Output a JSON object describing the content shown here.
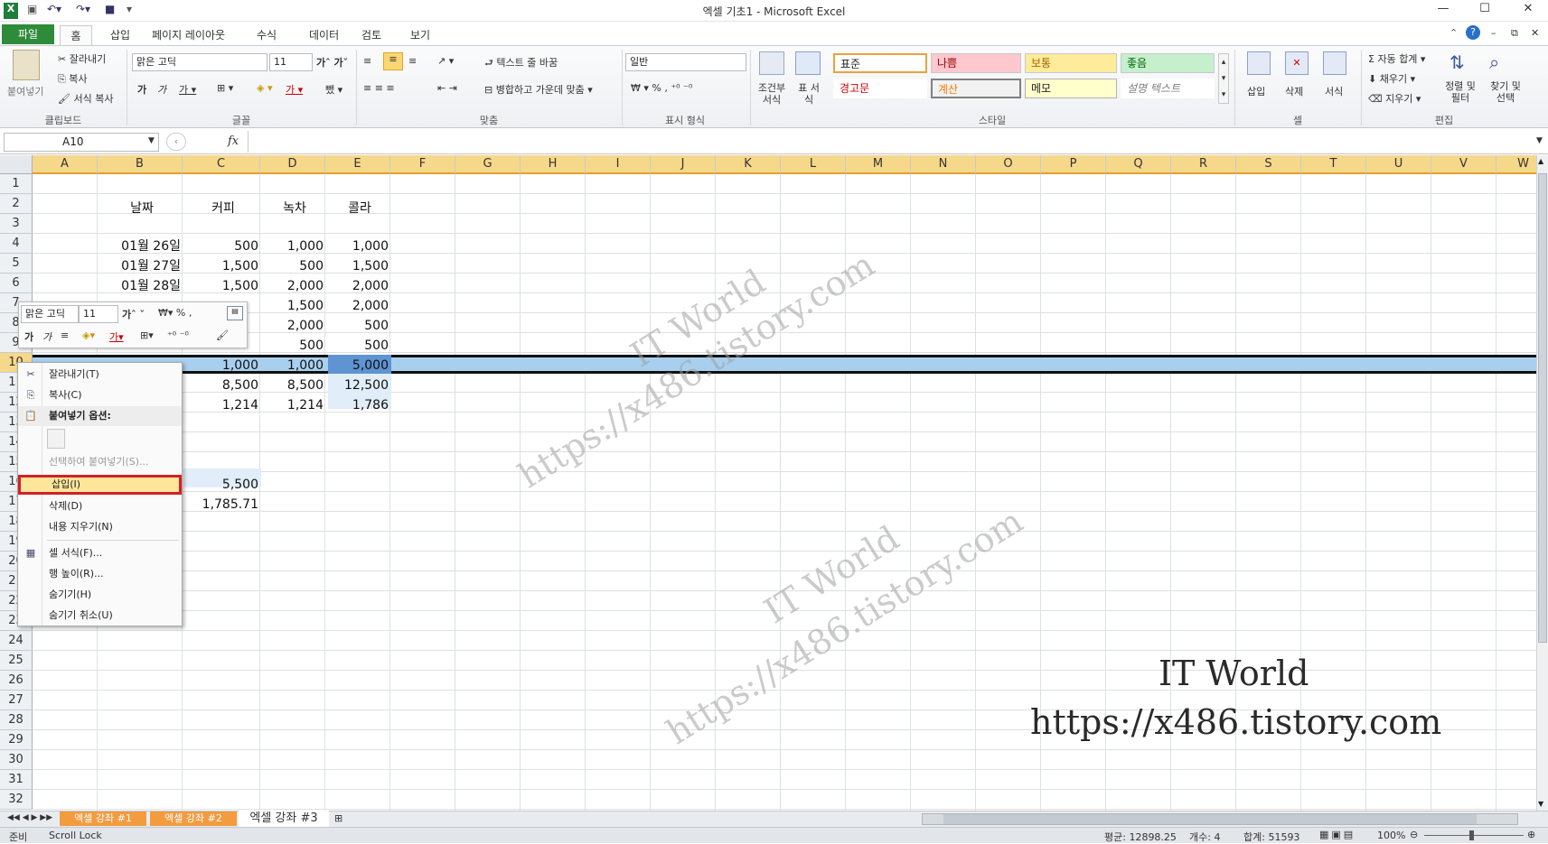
{
  "window": {
    "title": "엑셀 기초1 - Microsoft Excel"
  },
  "tabs": [
    "파일",
    "홈",
    "삽입",
    "페이지 레이아웃",
    "수식",
    "데이터",
    "검토",
    "보기"
  ],
  "ribbon": {
    "clipboard": {
      "paste": "붙여넣기",
      "cut": "잘라내기",
      "copy": "복사",
      "format_painter": "서식 복사",
      "label": "클립보드"
    },
    "font": {
      "name": "맑은 고딕",
      "size": "11",
      "label": "글꼴"
    },
    "alignment": {
      "wrap": "텍스트 줄 바꿈",
      "merge": "병합하고 가운데 맞춤",
      "label": "맞춤"
    },
    "number": {
      "format": "일반",
      "label": "표시 형식"
    },
    "styles": {
      "conditional": "조건부 서식",
      "table": "표 서식",
      "cells": [
        "표준",
        "나쁨",
        "보통",
        "좋음",
        "경고문",
        "계산",
        "메모",
        "설명 텍스트"
      ],
      "label": "스타일"
    },
    "cells": {
      "insert": "삽입",
      "delete": "삭제",
      "format": "서식",
      "label": "셀"
    },
    "editing": {
      "autosum": "자동 합계",
      "fill": "채우기",
      "clear": "지우기",
      "sort": "정렬 및 필터",
      "find": "찾기 및 선택",
      "label": "편집"
    }
  },
  "formula_bar": {
    "name_box": "A10",
    "fx": "fx",
    "value": ""
  },
  "columns": [
    "A",
    "B",
    "C",
    "D",
    "E",
    "F",
    "G",
    "H",
    "I",
    "J",
    "K",
    "L",
    "M",
    "N",
    "O",
    "P",
    "Q",
    "R",
    "S",
    "T",
    "U",
    "V",
    "W"
  ],
  "rows": [
    "1",
    "2",
    "3",
    "4",
    "5",
    "6",
    "7",
    "8",
    "9",
    "10",
    "11",
    "12",
    "13",
    "14",
    "15",
    "16",
    "17",
    "18",
    "19",
    "20",
    "21",
    "22",
    "23",
    "24",
    "25",
    "26",
    "27",
    "28",
    "29",
    "30",
    "31",
    "32"
  ],
  "table": {
    "headers": [
      "날짜",
      "커피",
      "녹차",
      "콜라"
    ],
    "data": [
      [
        "01월 26일",
        "500",
        "1,000",
        "1,000"
      ],
      [
        "01월 27일",
        "1,500",
        "500",
        "1,500"
      ],
      [
        "01월 28일",
        "1,500",
        "2,000",
        "2,000"
      ],
      [
        "",
        "",
        "1,500",
        "2,000"
      ],
      [
        "",
        "",
        "2,000",
        "500"
      ],
      [
        "",
        "",
        "500",
        "500"
      ],
      [
        "",
        "1,000",
        "1,000",
        "5,000"
      ],
      [
        "",
        "8,500",
        "8,500",
        "12,500"
      ],
      [
        "",
        "1,214",
        "1,214",
        "1,786"
      ]
    ],
    "extra": [
      "5,500",
      "1,785.71"
    ]
  },
  "mini_toolbar": {
    "font": "맑은 고딕",
    "size": "11"
  },
  "context_menu": {
    "items": [
      "잘라내기(T)",
      "복사(C)",
      "붙여넣기 옵션:",
      "선택하여 붙여넣기(S)...",
      "삽입(I)",
      "삭제(D)",
      "내용 지우기(N)",
      "셀 서식(F)...",
      "행 높이(R)...",
      "숨기기(H)",
      "숨기기 취소(U)"
    ]
  },
  "sheets": [
    "엑셀 강좌 #1",
    "엑셀 강좌 #2",
    "엑셀 강좌 #3"
  ],
  "status": {
    "ready": "준비",
    "scroll_lock": "Scroll Lock",
    "average": "평균: 12898.25",
    "count": "개수: 4",
    "sum": "합계: 51593",
    "zoom": "100%"
  },
  "watermark": {
    "line1": "IT World",
    "line2": "https://x486.tistory.com"
  }
}
